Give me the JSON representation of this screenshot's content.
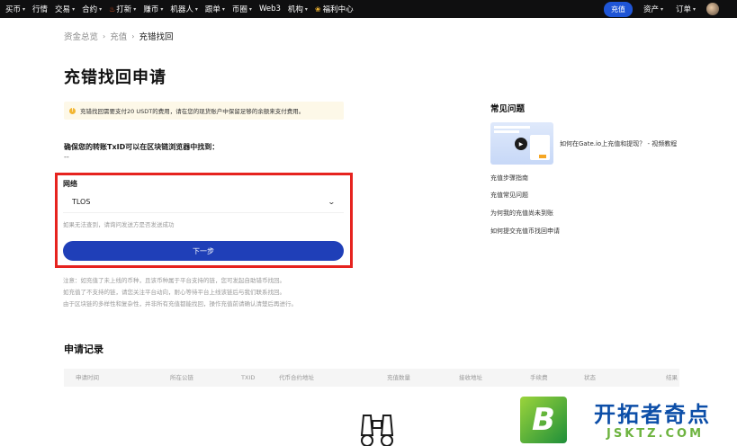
{
  "topnav": {
    "items": [
      {
        "label": "买币",
        "caret": true
      },
      {
        "label": "行情",
        "caret": false
      },
      {
        "label": "交易",
        "caret": true
      },
      {
        "label": "合约",
        "caret": true
      },
      {
        "label": "打新",
        "caret": true,
        "icon": "flame-icon"
      },
      {
        "label": "赚币",
        "caret": true
      },
      {
        "label": "机器人",
        "caret": true
      },
      {
        "label": "跟单",
        "caret": true
      },
      {
        "label": "币圈",
        "caret": true
      },
      {
        "label": "Web3",
        "caret": false
      },
      {
        "label": "机构",
        "caret": true
      },
      {
        "label": "福利中心",
        "caret": false,
        "icon": "gift-icon"
      }
    ],
    "deposit_button": "充值",
    "assets": "资产",
    "orders": "订单",
    "caret": "▾"
  },
  "breadcrumb": {
    "items": [
      "资金总览",
      "充值",
      "充错找回"
    ],
    "separator": "›"
  },
  "page_title": "充错找回申请",
  "notice": {
    "icon": "!",
    "text": "充错找回需要支付20 USDT的费用，请在您的现货账户中保留足够的余额来支付费用。"
  },
  "txid_section": {
    "question": "确保您的转账TxID可以在区块链浏览器中找到：",
    "value": "--"
  },
  "network": {
    "label": "网络",
    "selected": "TLOS",
    "chevron": "⌄",
    "hint": "如果无法查到，请询问发送方是否发送成功"
  },
  "next_button": "下一步",
  "notes": [
    "注意：如充值了未上线的币种，且该币种属于平台支持的链，您可发起自助错币找回。",
    "如充值了不支持的链，请您关注平台动向，耐心等待平台上线该链后与我们联系找回。",
    "由于区块链的多样性和复杂性，并非所有充值都能找回，操作充值前请确认清楚后再进行。"
  ],
  "records": {
    "title": "申请记录",
    "columns": [
      "申请时间",
      "所在公链",
      "TXID",
      "代币合约地址",
      "充值数量",
      "接收地址",
      "手续费",
      "状态",
      "结果"
    ]
  },
  "faq": {
    "title": "常见问题",
    "video_caption": "如何在Gate.io上充值和提现？ - 视频教程",
    "links": [
      "充值步骤指南",
      "充值常见问题",
      "为何我的充值尚未到账",
      "如何提交充值币找回申请"
    ]
  },
  "watermark": {
    "letter": "B",
    "name": "开拓者奇点",
    "url": "JSKTZ.COM"
  }
}
